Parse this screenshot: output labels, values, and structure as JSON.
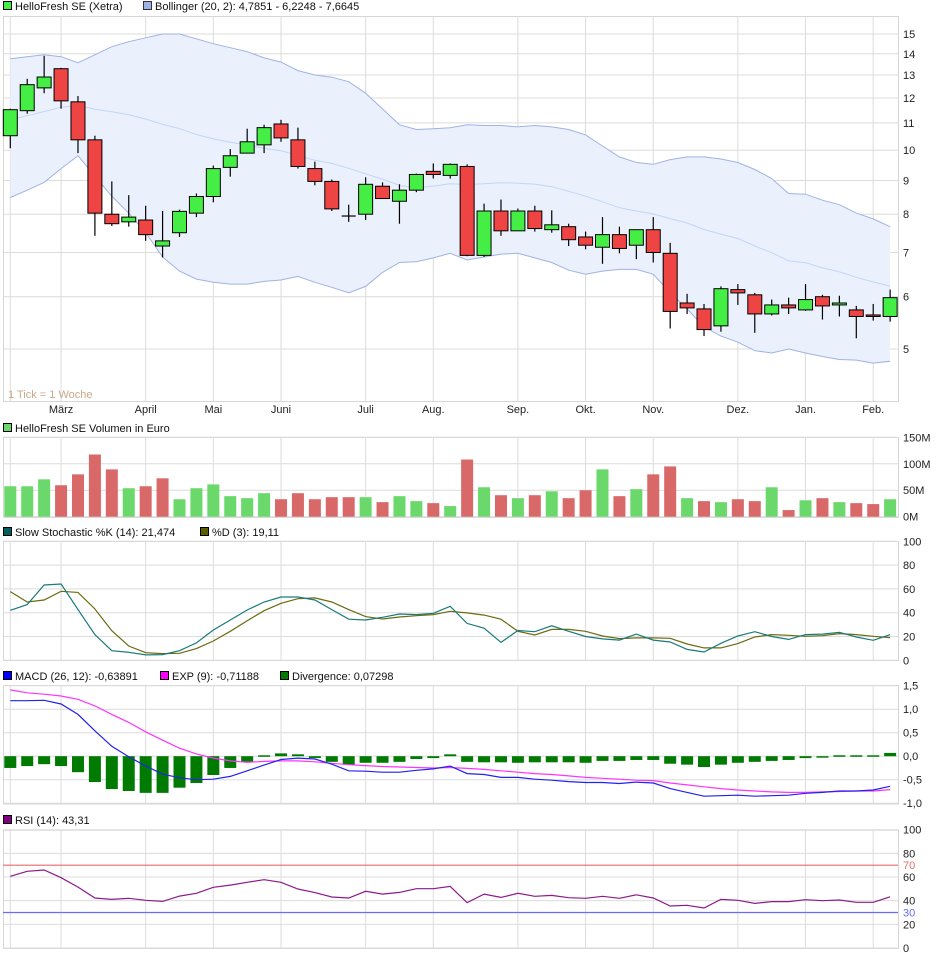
{
  "legends": {
    "price": "HelloFresh SE (Xetra)",
    "bollinger": "Bollinger (20, 2): 4,7851 - 6,2248 - 7,6645",
    "volume": "HelloFresh SE Volumen in Euro",
    "stoch_k": "Slow Stochastic %K (14): 21,474",
    "stoch_d": "%D (3): 19,11",
    "macd": "MACD (26, 12): -0,63891",
    "exp": "EXP (9): -0,71188",
    "divergence": "Divergence: 0,07298",
    "rsi": "RSI (14): 43,31"
  },
  "tick_note": "1 Tick = 1 Woche",
  "colors": {
    "up": "#44ee44",
    "down": "#ee4444",
    "vol_up": "#6ad86a",
    "vol_down": "#d96868",
    "band_fill": "#eaf0fc",
    "band_line": "#9fb3e3",
    "band_mid": "#c3d5f7",
    "stoch_k": "#1a7a7a",
    "stoch_d": "#6b6b10",
    "macd": "#2222ee",
    "exp": "#ff33ff",
    "divergence": "#007a00",
    "rsi": "#8b1a8b",
    "rsi_70": "#e86a6a",
    "rsi_30": "#6a6aff"
  },
  "chart_data": {
    "type": "candlestick",
    "interval": "weekly",
    "months": [
      {
        "label": "März",
        "index": 3
      },
      {
        "label": "April",
        "index": 8
      },
      {
        "label": "Mai",
        "index": 12
      },
      {
        "label": "Juni",
        "index": 16
      },
      {
        "label": "Juli",
        "index": 21
      },
      {
        "label": "Aug.",
        "index": 25
      },
      {
        "label": "Sep.",
        "index": 30
      },
      {
        "label": "Okt.",
        "index": 34
      },
      {
        "label": "Nov.",
        "index": 38
      },
      {
        "label": "Dez.",
        "index": 43
      },
      {
        "label": "Jan.",
        "index": 47
      },
      {
        "label": "Feb.",
        "index": 51
      }
    ],
    "price": {
      "scale": "log",
      "yticks": [
        "15",
        "14",
        "13",
        "12",
        "11",
        "10",
        "9",
        "8",
        "7",
        "6",
        "5"
      ],
      "ytick_values": [
        15,
        14,
        13,
        12,
        11,
        10,
        9,
        8,
        7,
        6,
        5
      ],
      "open": [
        10.52,
        11.48,
        12.43,
        13.29,
        11.84,
        10.37,
        8.0,
        7.79,
        7.84,
        7.16,
        7.5,
        8.03,
        8.51,
        9.42,
        9.9,
        10.19,
        10.96,
        10.37,
        9.38,
        8.97,
        7.95,
        8.0,
        8.82,
        8.37,
        8.7,
        9.29,
        9.16,
        9.45,
        6.93,
        8.09,
        7.55,
        8.09,
        7.58,
        7.66,
        7.39,
        7.13,
        7.45,
        7.18,
        7.58,
        6.98,
        5.87,
        5.75,
        5.42,
        6.15,
        6.04,
        5.65,
        5.83,
        5.73,
        6.0,
        5.83,
        5.73,
        5.63,
        5.6
      ],
      "high": [
        11.56,
        12.83,
        13.9,
        13.33,
        12.08,
        10.52,
        8.97,
        8.55,
        8.24,
        8.09,
        8.13,
        8.6,
        9.48,
        10.04,
        10.78,
        10.93,
        11.12,
        10.82,
        9.61,
        9.03,
        8.27,
        9.1,
        8.94,
        8.88,
        9.22,
        9.55,
        9.55,
        9.52,
        8.3,
        8.42,
        8.16,
        8.24,
        8.11,
        7.74,
        7.53,
        7.92,
        7.66,
        7.58,
        7.92,
        7.24,
        6.06,
        5.85,
        6.22,
        6.27,
        6.08,
        5.94,
        5.98,
        6.27,
        6.04,
        6.02,
        5.81,
        5.85,
        6.15
      ],
      "low": [
        10.07,
        11.36,
        12.2,
        11.56,
        9.9,
        7.42,
        7.68,
        7.66,
        7.29,
        6.88,
        7.39,
        7.92,
        8.34,
        9.12,
        9.9,
        9.9,
        10.3,
        9.38,
        8.85,
        8.09,
        7.79,
        7.84,
        8.45,
        7.74,
        8.64,
        9.06,
        9.06,
        6.91,
        6.89,
        7.42,
        7.55,
        7.53,
        7.5,
        7.16,
        7.08,
        6.73,
        6.98,
        6.84,
        6.76,
        5.37,
        5.65,
        5.23,
        5.31,
        5.83,
        5.29,
        5.62,
        5.65,
        5.71,
        5.54,
        5.6,
        5.19,
        5.52,
        5.5
      ],
      "close": [
        11.52,
        12.57,
        12.91,
        11.88,
        10.37,
        8.03,
        7.74,
        7.92,
        7.45,
        7.29,
        8.08,
        8.51,
        9.38,
        9.81,
        10.3,
        10.82,
        10.44,
        9.45,
        8.97,
        8.15,
        7.95,
        8.88,
        8.45,
        8.7,
        9.19,
        9.19,
        9.52,
        6.93,
        8.09,
        7.55,
        8.09,
        7.61,
        7.71,
        7.32,
        7.18,
        7.45,
        7.1,
        7.58,
        7.0,
        5.7,
        5.77,
        5.35,
        6.17,
        6.08,
        5.65,
        5.83,
        5.77,
        5.94,
        5.81,
        5.87,
        5.6,
        5.6,
        5.98
      ],
      "bollinger_upper": [
        13.76,
        13.86,
        13.95,
        13.86,
        13.57,
        13.95,
        14.35,
        14.6,
        14.8,
        15,
        15,
        14.75,
        14.5,
        14.3,
        14.1,
        13.8,
        13.6,
        13.2,
        13,
        12.9,
        12.7,
        12.2,
        11.55,
        10.93,
        10.75,
        10.78,
        10.82,
        10.93,
        10.9,
        10.9,
        10.85,
        10.9,
        10.85,
        10.75,
        10.55,
        10.15,
        9.77,
        9.58,
        9.52,
        9.68,
        9.77,
        9.77,
        9.7,
        9.58,
        9.35,
        9.06,
        8.6,
        8.58,
        8.4,
        8.27,
        8.03,
        7.87,
        7.66
      ],
      "bollinger_lower": [
        8.48,
        8.7,
        8.94,
        9.38,
        9.81,
        9.13,
        8.52,
        8.03,
        7.5,
        6.89,
        6.56,
        6.38,
        6.31,
        6.27,
        6.27,
        6.33,
        6.36,
        6.44,
        6.31,
        6.2,
        6.08,
        6.22,
        6.53,
        6.76,
        6.78,
        6.87,
        6.98,
        6.82,
        6.89,
        6.96,
        6.98,
        6.87,
        6.76,
        6.58,
        6.49,
        6.56,
        6.6,
        6.6,
        6.49,
        6.08,
        5.75,
        5.4,
        5.23,
        5.12,
        4.97,
        4.93,
        5.0,
        4.93,
        4.87,
        4.82,
        4.81,
        4.76,
        4.79
      ]
    },
    "volume": {
      "unit": "M EUR",
      "yticks": [
        "150M",
        "100M",
        "50M",
        "0M"
      ],
      "ytick_values": [
        150,
        100,
        50,
        0
      ],
      "ylim": [
        0,
        150
      ],
      "values": [
        57.5,
        57.5,
        70.6,
        59.4,
        80,
        117.5,
        89.4,
        53.8,
        57.5,
        72.5,
        33,
        53.8,
        61,
        38.8,
        35,
        44.4,
        33,
        44.4,
        33,
        36.9,
        36.9,
        36.9,
        27.5,
        38.8,
        29.4,
        25.6,
        20,
        108,
        55.6,
        40.6,
        35,
        40.6,
        48,
        35,
        50,
        89.4,
        38.8,
        52,
        80,
        95,
        35,
        29.4,
        27.5,
        33,
        29.4,
        55.6,
        12.5,
        31,
        35,
        27.5,
        25.6,
        23.8,
        33
      ],
      "up": [
        1,
        1,
        1,
        0,
        0,
        0,
        0,
        1,
        0,
        0,
        1,
        1,
        1,
        1,
        1,
        1,
        0,
        0,
        0,
        0,
        0,
        1,
        0,
        1,
        1,
        0,
        1,
        0,
        1,
        0,
        1,
        0,
        1,
        0,
        0,
        1,
        0,
        1,
        0,
        0,
        1,
        0,
        1,
        0,
        0,
        1,
        0,
        1,
        0,
        1,
        0,
        0,
        1
      ]
    },
    "stochastic": {
      "yticks": [
        "100",
        "80",
        "60",
        "40",
        "20",
        "0"
      ],
      "ytick_values": [
        100,
        80,
        60,
        40,
        20,
        0
      ],
      "ylim": [
        0,
        100
      ],
      "k": [
        42,
        46.8,
        63.3,
        64.1,
        42.6,
        21.6,
        8.1,
        6.7,
        4.5,
        4.8,
        8.1,
        14.6,
        25.5,
        33.9,
        42.3,
        49,
        53.2,
        53.2,
        50.7,
        42.6,
        34.5,
        33.9,
        36.1,
        38.9,
        38.4,
        39.5,
        45.4,
        31,
        27,
        15,
        25,
        24,
        29,
        24.4,
        20,
        18,
        17,
        22,
        17,
        15.4,
        9.2,
        7,
        14.3,
        20.4,
        24,
        20,
        17.6,
        21.6,
        22,
        23.5,
        19.6,
        16.8,
        21.5
      ],
      "d": [
        57.7,
        49,
        50.7,
        58,
        57.1,
        43.1,
        24.9,
        12,
        6.4,
        5.6,
        5.9,
        9.8,
        16.2,
        24.4,
        33.3,
        41.7,
        47.9,
        51.8,
        52.4,
        49,
        42.6,
        36.7,
        34.7,
        36.4,
        37.5,
        38.4,
        41.2,
        39.8,
        38,
        34.5,
        24.4,
        21.3,
        26,
        26,
        24.4,
        20.4,
        18.2,
        18.8,
        18.8,
        18.5,
        13.7,
        10.4,
        10.4,
        14,
        19.6,
        21.6,
        21,
        20.2,
        20.7,
        22.4,
        21.6,
        20.2,
        19.1
      ]
    },
    "macd": {
      "yticks": [
        "1,5",
        "1,0",
        "0,5",
        "0,0",
        "-0,5",
        "-1,0"
      ],
      "ytick_values": [
        1.5,
        1.0,
        0.5,
        0,
        -0.5,
        -1.0
      ],
      "ylim": [
        -1.0,
        1.5
      ],
      "macd": [
        1.18,
        1.18,
        1.19,
        1.11,
        0.89,
        0.54,
        0.21,
        -0.01,
        -0.21,
        -0.38,
        -0.46,
        -0.5,
        -0.49,
        -0.43,
        -0.31,
        -0.19,
        -0.07,
        -0.04,
        -0.06,
        -0.17,
        -0.31,
        -0.32,
        -0.34,
        -0.34,
        -0.3,
        -0.27,
        -0.21,
        -0.37,
        -0.39,
        -0.45,
        -0.45,
        -0.49,
        -0.51,
        -0.54,
        -0.56,
        -0.56,
        -0.58,
        -0.55,
        -0.57,
        -0.69,
        -0.77,
        -0.85,
        -0.84,
        -0.83,
        -0.85,
        -0.84,
        -0.83,
        -0.79,
        -0.77,
        -0.74,
        -0.74,
        -0.72,
        -0.64
      ],
      "exp": [
        1.41,
        1.35,
        1.32,
        1.28,
        1.21,
        1.07,
        0.89,
        0.72,
        0.52,
        0.34,
        0.17,
        0.05,
        -0.04,
        -0.1,
        -0.13,
        -0.11,
        -0.1,
        -0.1,
        -0.12,
        -0.15,
        -0.18,
        -0.2,
        -0.22,
        -0.23,
        -0.24,
        -0.25,
        -0.24,
        -0.26,
        -0.28,
        -0.31,
        -0.34,
        -0.37,
        -0.39,
        -0.42,
        -0.45,
        -0.47,
        -0.49,
        -0.51,
        -0.52,
        -0.57,
        -0.61,
        -0.65,
        -0.69,
        -0.72,
        -0.74,
        -0.76,
        -0.77,
        -0.77,
        -0.76,
        -0.75,
        -0.74,
        -0.74,
        -0.71
      ],
      "divergence": [
        -0.25,
        -0.21,
        -0.17,
        -0.21,
        -0.34,
        -0.55,
        -0.7,
        -0.74,
        -0.78,
        -0.78,
        -0.67,
        -0.57,
        -0.4,
        -0.25,
        -0.12,
        0.02,
        0.06,
        0.04,
        -0.04,
        -0.12,
        -0.18,
        -0.14,
        -0.14,
        -0.12,
        -0.06,
        -0.04,
        0.04,
        -0.12,
        -0.13,
        -0.13,
        -0.14,
        -0.13,
        -0.13,
        -0.13,
        -0.14,
        -0.1,
        -0.1,
        -0.08,
        -0.08,
        -0.16,
        -0.18,
        -0.23,
        -0.18,
        -0.14,
        -0.12,
        -0.1,
        -0.08,
        -0.04,
        -0.01,
        0.02,
        0.02,
        0.02,
        0.07
      ]
    },
    "rsi": {
      "yticks": [
        "100",
        "80",
        "70",
        "60",
        "40",
        "30",
        "20",
        "0"
      ],
      "ytick_values": [
        100,
        80,
        70,
        60,
        40,
        30,
        20,
        0
      ],
      "ylim": [
        0,
        100
      ],
      "overbought": 70,
      "oversold": 30,
      "values": [
        60.6,
        64.8,
        65.9,
        59.4,
        51.5,
        42.3,
        41.1,
        42,
        40.3,
        39.4,
        43.9,
        46.2,
        51.3,
        53.2,
        55.5,
        57.7,
        55.5,
        49.9,
        46.8,
        43.1,
        42.3,
        47.9,
        45.6,
        47,
        50.1,
        50.1,
        52.1,
        38.3,
        45.6,
        42.8,
        46.2,
        43.7,
        44.5,
        42.5,
        42,
        43.7,
        42,
        45,
        42.3,
        35.5,
        36.1,
        33.8,
        41.1,
        40.3,
        37.7,
        39.2,
        39.2,
        40.8,
        40,
        40.6,
        38.6,
        38.6,
        43.3
      ]
    }
  }
}
